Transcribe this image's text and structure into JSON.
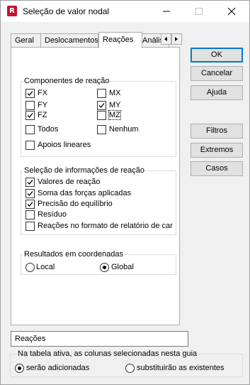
{
  "window": {
    "title": "Seleção de valor nodal",
    "icon_letter": "R"
  },
  "tabs": [
    {
      "label": "Geral",
      "active": false
    },
    {
      "label": "Deslocamentos",
      "active": false
    },
    {
      "label": "Reações",
      "active": true
    },
    {
      "label": "Anális",
      "active": false
    }
  ],
  "components_group": {
    "title": "Componentes de reação",
    "items": [
      {
        "label": "FX",
        "checked": true
      },
      {
        "label": "MX",
        "checked": false
      },
      {
        "label": "FY",
        "checked": false
      },
      {
        "label": "MY",
        "checked": true
      },
      {
        "label": "FZ",
        "checked": true
      },
      {
        "label": "MZ",
        "checked": false
      },
      {
        "label": "Todos",
        "checked": false
      },
      {
        "label": "Nenhum",
        "checked": false
      }
    ],
    "supports": {
      "label": "Apoios lineares",
      "checked": false
    }
  },
  "info_group": {
    "title": "Seleção de informações de reação",
    "items": [
      {
        "label": "Valores de reação",
        "checked": true
      },
      {
        "label": "Soma das forças aplicadas",
        "checked": true
      },
      {
        "label": "Precisão do equilíbrio",
        "checked": true
      },
      {
        "label": "Resíduo",
        "checked": false
      },
      {
        "label": "Reações no formato de relatório de carg",
        "checked": false
      }
    ]
  },
  "coords_group": {
    "title": "Resultados em coordenadas",
    "options": [
      {
        "label": "Local",
        "selected": false
      },
      {
        "label": "Global",
        "selected": true
      }
    ]
  },
  "buttons": {
    "ok": "OK",
    "cancel": "Cancelar",
    "help": "Ajuda",
    "filters": "Filtros",
    "extremes": "Extremos",
    "cases": "Casos"
  },
  "name_field": {
    "value": "Reações"
  },
  "active_table_group": {
    "title": "Na tabela ativa, as colunas selecionadas nesta guia",
    "options": [
      {
        "label": "serão adicionadas",
        "selected": true
      },
      {
        "label": "substituirão as existentes",
        "selected": false
      }
    ]
  }
}
